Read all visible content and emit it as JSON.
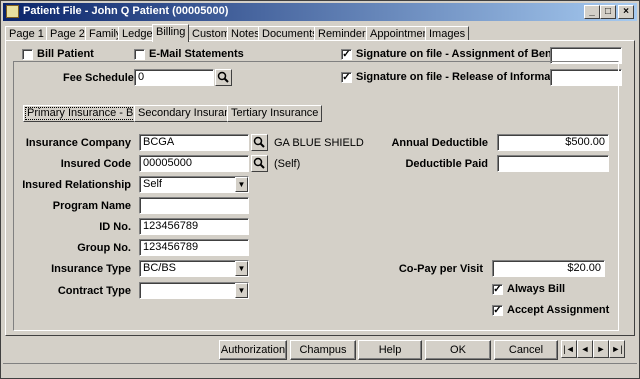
{
  "window": {
    "title": "Patient File - John Q Patient (00005000)",
    "controls": {
      "minimize": "_",
      "maximize": "□",
      "close": "×"
    }
  },
  "tabs": [
    "Page 1",
    "Page 2",
    "Family",
    "Ledger",
    "Billing",
    "Custom",
    "Notes",
    "Documents",
    "Reminders",
    "Appointments",
    "Images"
  ],
  "active_tab": "Billing",
  "top": {
    "bill_patient": {
      "label": "Bill Patient",
      "checked": false
    },
    "email_statements": {
      "label": "E-Mail Statements",
      "checked": false
    },
    "fee_schedule": {
      "label": "Fee Schedule",
      "value": "0"
    },
    "sig_assignment": {
      "label": "Signature on file - Assignment of Benefits",
      "checked": true,
      "value": ""
    },
    "sig_release": {
      "label": "Signature on file - Release of Information",
      "checked": true,
      "value": ""
    }
  },
  "insurance_tabs": [
    "Primary Insurance - BCGA",
    "Secondary Insurance",
    "Tertiary Insurance"
  ],
  "insurance": {
    "company": {
      "label": "Insurance Company",
      "value": "BCGA",
      "name": "GA BLUE SHIELD"
    },
    "insured_code": {
      "label": "Insured Code",
      "value": "00005000",
      "note": "(Self)"
    },
    "relationship": {
      "label": "Insured Relationship",
      "value": "Self"
    },
    "program_name": {
      "label": "Program Name",
      "value": ""
    },
    "id_no": {
      "label": "ID No.",
      "value": "123456789"
    },
    "group_no": {
      "label": "Group No.",
      "value": "123456789"
    },
    "type": {
      "label": "Insurance Type",
      "value": "BC/BS"
    },
    "contract_type": {
      "label": "Contract Type",
      "value": ""
    },
    "annual_deductible": {
      "label": "Annual Deductible",
      "value": "$500.00"
    },
    "deductible_paid": {
      "label": "Deductible Paid",
      "value": ""
    },
    "copay": {
      "label": "Co-Pay per Visit",
      "value": "$20.00"
    },
    "always_bill": {
      "label": "Always Bill",
      "checked": true
    },
    "accept_assignment": {
      "label": "Accept Assignment",
      "checked": true
    }
  },
  "buttons": {
    "authorization": "Authorization",
    "champus": "Champus",
    "help": "Help",
    "ok": "OK",
    "cancel": "Cancel"
  },
  "nav": {
    "first": "|◄",
    "prev": "◄",
    "next": "►",
    "last": "►|"
  },
  "colors": {
    "face": "#d4d0c8",
    "title_start": "#0a246a",
    "title_end": "#a6caf0"
  }
}
